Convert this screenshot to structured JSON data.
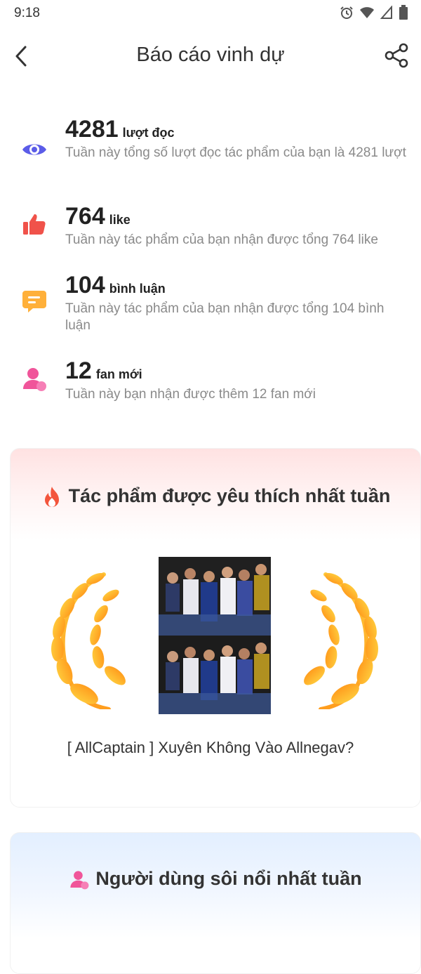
{
  "status_bar": {
    "time": "9:18",
    "icons": [
      "alarm-icon",
      "wifi-icon",
      "signal-icon",
      "battery-icon"
    ]
  },
  "header": {
    "title": "Báo cáo vinh dự",
    "back_icon": "chevron-left-icon",
    "share_icon": "share-icon"
  },
  "stats": [
    {
      "number": "4281",
      "unit": "lượt đọc",
      "desc": "Tuần này tổng số lượt đọc tác phẩm của bạn là 4281 lượt",
      "icon": "eye-icon",
      "color": "#5b5ce8"
    },
    {
      "number": "764",
      "unit": "like",
      "desc": "Tuần này tác phẩm của bạn nhận được tổng 764 like",
      "icon": "thumbs-up-icon",
      "color": "#f0524a"
    },
    {
      "number": "104",
      "unit": "bình luận",
      "desc": "Tuần này tác phẩm của bạn nhận được tổng 104 bình luận",
      "icon": "comment-icon",
      "color": "#ffb03a"
    },
    {
      "number": "12",
      "unit": "fan mới",
      "desc": "Tuần này bạn nhận được thêm 12 fan mới",
      "icon": "user-icon",
      "color": "#f0559a"
    }
  ],
  "favorite_work": {
    "title": "Tác phẩm được yêu thích nhất tuần",
    "work_title": "[ AllCaptain ] Xuyên Không Vào Allnegav?"
  },
  "top_user": {
    "title": "Người dùng sôi nổi nhất tuần"
  }
}
